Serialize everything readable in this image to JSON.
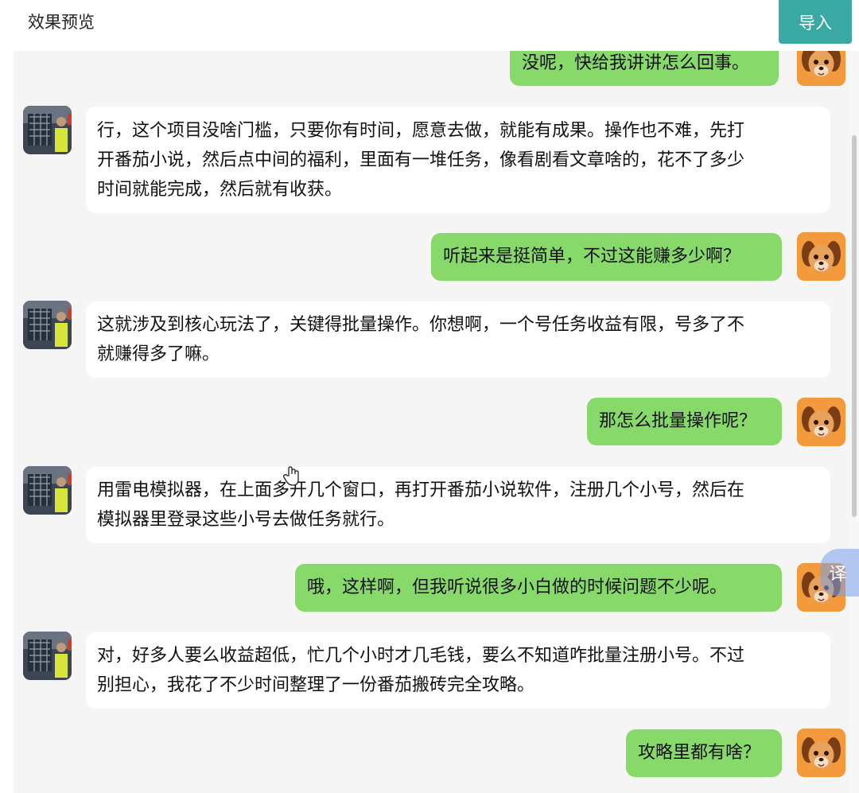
{
  "header": {
    "title": "效果预览",
    "import_label": "导入"
  },
  "colors": {
    "accent": "#3aa9a4",
    "outgoing_bubble": "#87d96a",
    "incoming_bubble": "#ffffff",
    "chat_background": "#f5f5f5"
  },
  "messages": [
    {
      "side": "right",
      "lines": [
        "没呢，快给我讲讲怎么回事。"
      ]
    },
    {
      "side": "left",
      "lines": [
        "行，这个项目没啥门槛，只要你有时间，愿意去做，就能有成果。操作也不难，先打",
        "开番茄小说，然后点中间的福利，里面有一堆任务，像看剧看文章啥的，花不了多少",
        "时间就能完成，然后就有收获。"
      ]
    },
    {
      "side": "right",
      "lines": [
        "听起来是挺简单，不过这能赚多少啊？"
      ]
    },
    {
      "side": "left",
      "lines": [
        "这就涉及到核心玩法了，关键得批量操作。你想啊，一个号任务收益有限，号多了不",
        "就赚得多了嘛。"
      ]
    },
    {
      "side": "right",
      "lines": [
        "那怎么批量操作呢？"
      ]
    },
    {
      "side": "left",
      "lines": [
        "用雷电模拟器，在上面多开几个窗口，再打开番茄小说软件，注册几个小号，然后在",
        "模拟器里登录这些小号去做任务就行。"
      ]
    },
    {
      "side": "right",
      "lines": [
        "哦，这样啊，但我听说很多小白做的时候问题不少呢。"
      ]
    },
    {
      "side": "left",
      "lines": [
        "对，好多人要么收益超低，忙几个小时才几毛钱，要么不知道咋批量注册小号。不过",
        "别担心，我花了不少时间整理了一份番茄搬砖完全攻略。"
      ]
    },
    {
      "side": "right",
      "lines": [
        "攻略里都有啥？"
      ]
    }
  ],
  "translate_label": "译",
  "icons": {
    "user_avatar": "cartoon-dog-avatar",
    "bot_avatar": "photo-avatar",
    "cursor": "hand-cursor-icon"
  }
}
